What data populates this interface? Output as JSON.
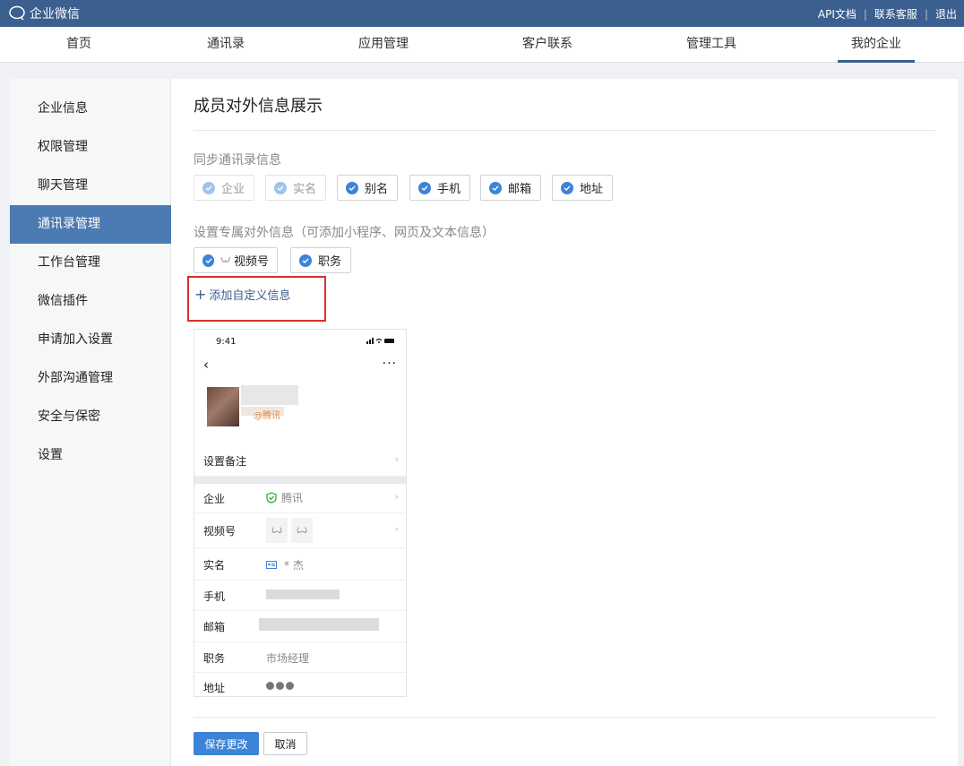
{
  "topbar": {
    "logo_text": "企业微信",
    "links": [
      "API文档",
      "联系客服",
      "退出"
    ],
    "bg": "#3b5f8e"
  },
  "nav": {
    "items": [
      "首页",
      "通讯录",
      "应用管理",
      "客户联系",
      "管理工具",
      "我的企业"
    ],
    "active": "我的企业"
  },
  "sidebar": {
    "items": [
      "企业信息",
      "权限管理",
      "聊天管理",
      "通讯录管理",
      "工作台管理",
      "微信插件",
      "申请加入设置",
      "外部沟通管理",
      "安全与保密",
      "设置"
    ],
    "active": "通讯录管理"
  },
  "main": {
    "title": "成员对外信息展示",
    "sync_label": "同步通讯录信息",
    "sync_options": [
      {
        "label": "企业",
        "checked": true,
        "disabled": true
      },
      {
        "label": "实名",
        "checked": true,
        "disabled": true
      },
      {
        "label": "别名",
        "checked": true,
        "disabled": false
      },
      {
        "label": "手机",
        "checked": true,
        "disabled": false
      },
      {
        "label": "邮箱",
        "checked": true,
        "disabled": false
      },
      {
        "label": "地址",
        "checked": true,
        "disabled": false
      }
    ],
    "custom_label": "设置专属对外信息（可添加小程序、网页及文本信息）",
    "custom_options": [
      {
        "label": "视频号",
        "checked": true,
        "icon": "channels-icon"
      },
      {
        "label": "职务",
        "checked": true
      }
    ],
    "add_link": "添加自定义信息",
    "save_button": "保存更改",
    "cancel_button": "取消",
    "accent": "#3c84d8"
  },
  "preview": {
    "time": "9:41",
    "company_tag": "@腾讯",
    "remark_label": "设置备注",
    "rows": [
      {
        "label": "企业",
        "value": "腾讯"
      },
      {
        "label": "视频号",
        "value": ""
      },
      {
        "label": "实名",
        "value": "* 杰"
      },
      {
        "label": "手机",
        "value": ""
      },
      {
        "label": "邮箱",
        "value": ""
      },
      {
        "label": "职务",
        "value": "市场经理"
      },
      {
        "label": "地址",
        "value": ""
      }
    ]
  }
}
